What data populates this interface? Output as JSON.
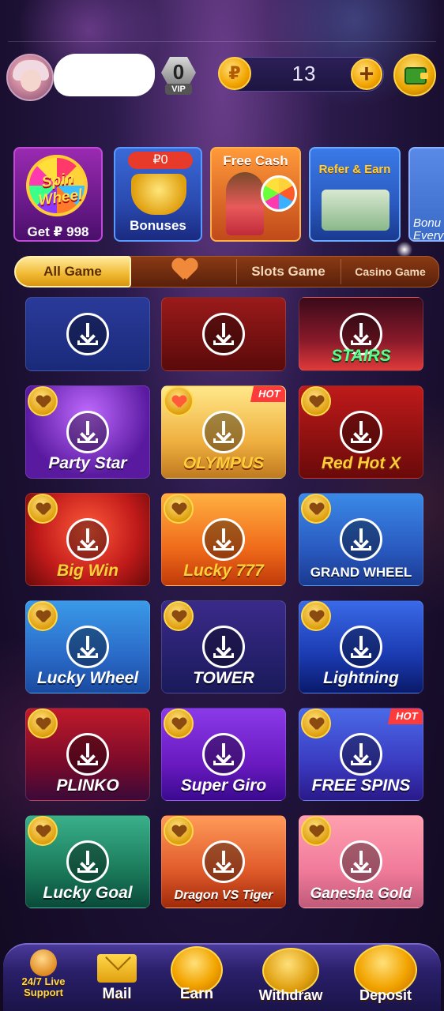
{
  "header": {
    "vip_level": "0",
    "vip_label": "VIP",
    "currency_symbol": "₽",
    "balance": "13",
    "add_symbol": "+"
  },
  "promos": {
    "spin_wheel": {
      "title": "Spin Wheel",
      "caption": "Get ₽ 998"
    },
    "bonuses": {
      "tag": "₽0",
      "caption": "Bonuses"
    },
    "free_cash": {
      "caption": "Free Cash"
    },
    "refer": {
      "caption": "Refer & Earn"
    },
    "bonus_every": {
      "line1": "Bonu",
      "line2": "Every"
    }
  },
  "tabs": {
    "all": "All Game",
    "slots": "Slots Game",
    "casino": "Casino Game"
  },
  "games": [
    {
      "title": "",
      "hot": ""
    },
    {
      "title": "",
      "hot": ""
    },
    {
      "title": "STAIRS",
      "hot": ""
    },
    {
      "title": "Party Star",
      "hot": ""
    },
    {
      "title": "OLYMPUS",
      "hot": "HOT"
    },
    {
      "title": "Red Hot X",
      "hot": ""
    },
    {
      "title": "Big Win",
      "hot": ""
    },
    {
      "title": "Lucky 777",
      "hot": ""
    },
    {
      "title": "GRAND WHEEL",
      "hot": ""
    },
    {
      "title": "Lucky Wheel",
      "hot": ""
    },
    {
      "title": "TOWER",
      "hot": ""
    },
    {
      "title": "Lightning",
      "hot": ""
    },
    {
      "title": "PLINKO",
      "hot": ""
    },
    {
      "title": "Super Giro",
      "hot": ""
    },
    {
      "title": "FREE SPINS",
      "hot": "HOT"
    },
    {
      "title": "Lucky Goal",
      "hot": ""
    },
    {
      "title": "Dragon VS Tiger",
      "hot": ""
    },
    {
      "title": "Ganesha Gold",
      "hot": ""
    }
  ],
  "bottom_nav": {
    "support_line1": "24/7 Live",
    "support_line2": "Support",
    "mail": "Mail",
    "earn": "Earn",
    "withdraw": "Withdraw",
    "deposit": "Deposit"
  },
  "colors": {
    "accent_gold": "#f2a400",
    "background": "#1a0f30",
    "tab_active": "#f0b830"
  }
}
